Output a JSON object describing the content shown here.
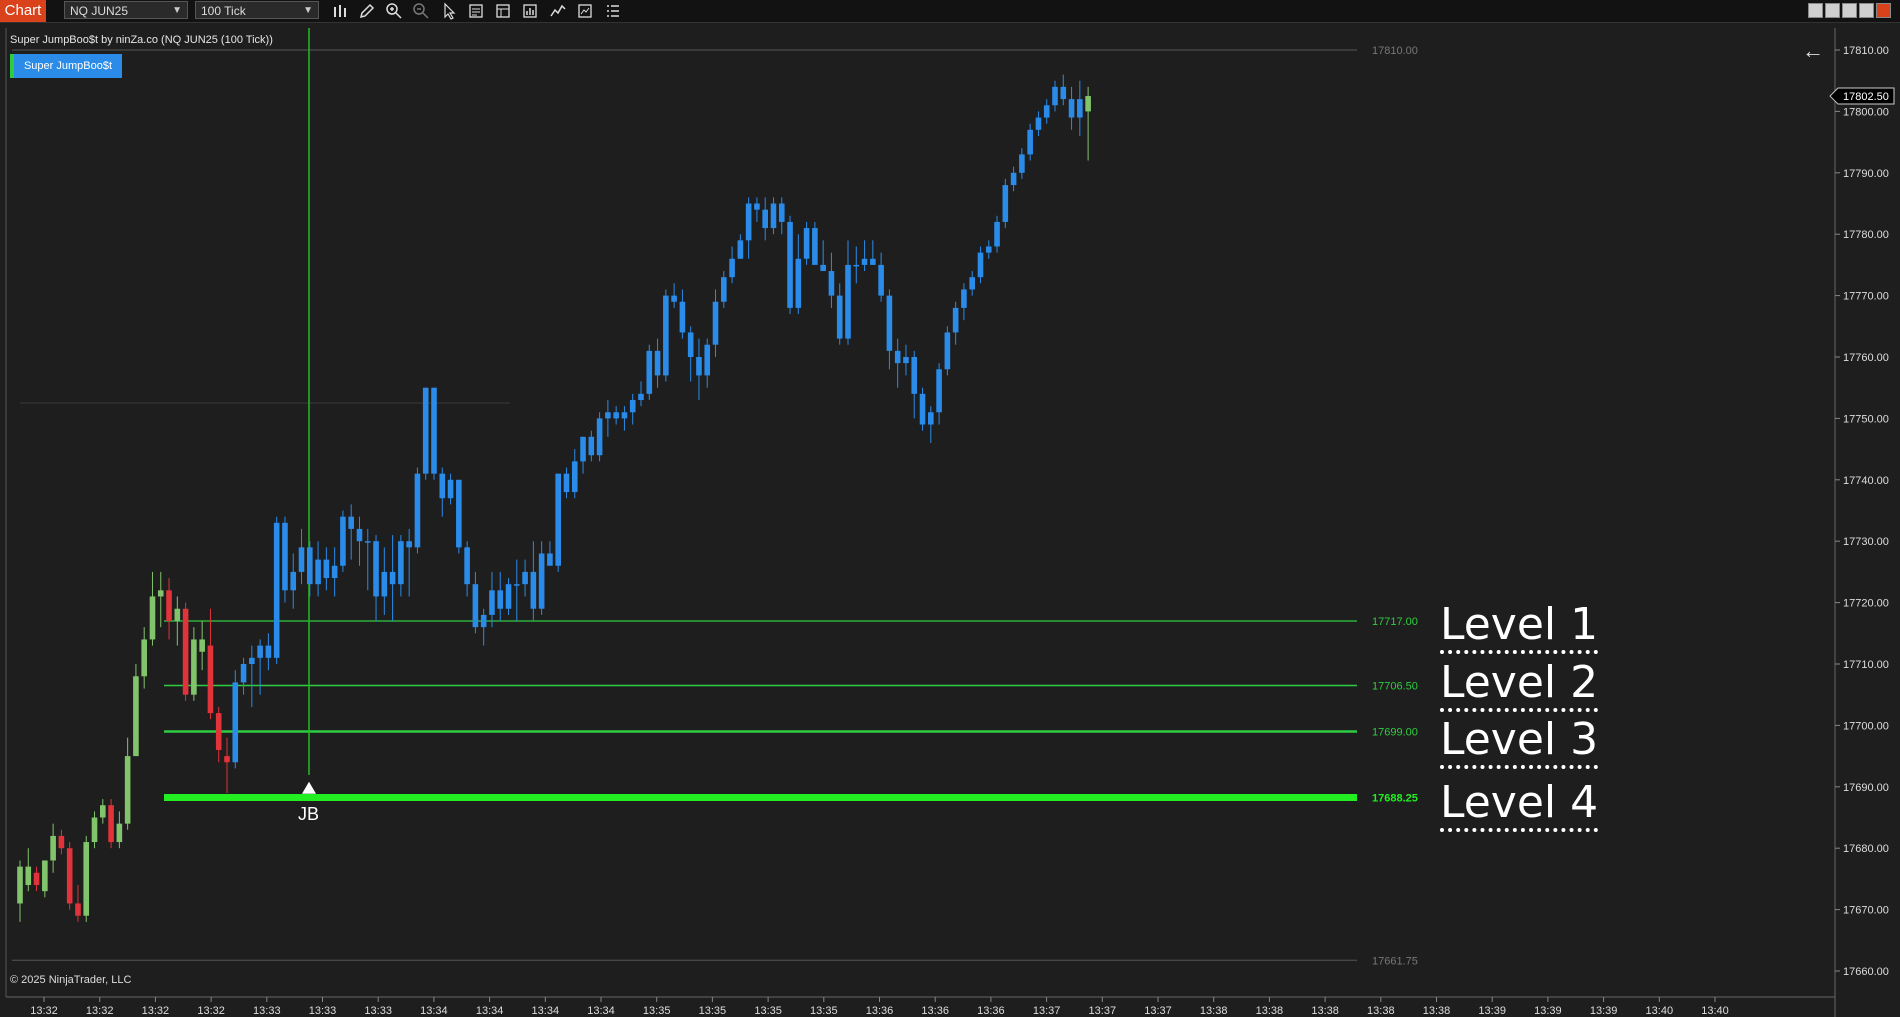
{
  "toolbar": {
    "chart_tab": "Chart",
    "instrument": "NQ JUN25",
    "interval": "100 Tick",
    "icons": [
      "bar-style-icon",
      "pencil-icon",
      "zoom-in-icon",
      "zoom-out-icon",
      "pointer-icon",
      "data-box-icon",
      "properties-icon",
      "chart-trader-icon",
      "indicators-icon",
      "strategies-icon",
      "list-icon"
    ]
  },
  "header": {
    "title": "Super JumpBoo$t by ninZa.co (NQ JUN25 (100 Tick))",
    "indicator_button": "Super JumpBoo$t"
  },
  "footer": {
    "copyright": "© 2025 NinjaTrader, LLC"
  },
  "colors": {
    "up": "#82c46c",
    "down": "#e0333a",
    "boost": "#2a8be8",
    "level": "#2ecc40",
    "level4": "#22ee22"
  },
  "chart_data": {
    "type": "candlestick",
    "ylim": [
      17658,
      17813
    ],
    "y_ticks": [
      "17810.00",
      "17800.00",
      "17790.00",
      "17780.00",
      "17770.00",
      "17760.00",
      "17750.00",
      "17740.00",
      "17730.00",
      "17720.00",
      "17710.00",
      "17700.00",
      "17690.00",
      "17680.00",
      "17670.00",
      "17660.00"
    ],
    "x_ticks": [
      "13:32",
      "13:32",
      "13:32",
      "13:32",
      "13:33",
      "13:33",
      "13:33",
      "13:34",
      "13:34",
      "13:34",
      "13:34",
      "13:35",
      "13:35",
      "13:35",
      "13:35",
      "13:36",
      "13:36",
      "13:36",
      "13:37",
      "13:37",
      "13:37",
      "13:38",
      "13:38",
      "13:38",
      "13:38",
      "13:38",
      "13:39",
      "13:39",
      "13:39",
      "13:40",
      "13:40"
    ],
    "last_price": "17802.50",
    "top_line": {
      "label": "17810.00",
      "value": 17810
    },
    "bottom_line": {
      "label": "17661.75",
      "value": 17661.75
    },
    "mid_line": {
      "value": 17752.5
    },
    "levels": [
      {
        "name": "Level 1",
        "label": "17717.00",
        "value": 17717
      },
      {
        "name": "Level 2",
        "label": "17706.50",
        "value": 17706.5
      },
      {
        "name": "Level 3",
        "label": "17699.00",
        "value": 17699
      },
      {
        "name": "Level 4",
        "label": "17688.25",
        "value": 17688.25
      }
    ],
    "signal": {
      "label": "JB",
      "value": 17690
    },
    "candles": [
      [
        17677,
        17671,
        17678,
        17668,
        "up"
      ],
      [
        17674,
        17677,
        17680,
        17673,
        "up"
      ],
      [
        17676,
        17674,
        17677,
        17673,
        "down"
      ],
      [
        17673,
        17678,
        17678,
        17672,
        "up"
      ],
      [
        17678,
        17682,
        17684,
        17676,
        "up"
      ],
      [
        17682,
        17680,
        17683,
        17679,
        "down"
      ],
      [
        17680,
        17671,
        17681,
        17670,
        "down"
      ],
      [
        17671,
        17669,
        17674,
        17668,
        "down"
      ],
      [
        17669,
        17681,
        17682,
        17668,
        "up"
      ],
      [
        17681,
        17685,
        17686,
        17680,
        "up"
      ],
      [
        17685,
        17687,
        17688,
        17684,
        "up"
      ],
      [
        17687,
        17681,
        17688,
        17680,
        "down"
      ],
      [
        17681,
        17684,
        17686,
        17680,
        "up"
      ],
      [
        17684,
        17695,
        17698,
        17683,
        "up"
      ],
      [
        17695,
        17708,
        17710,
        17695,
        "up"
      ],
      [
        17708,
        17714,
        17716,
        17706,
        "up"
      ],
      [
        17714,
        17721,
        17725,
        17713,
        "up"
      ],
      [
        17721,
        17722,
        17725,
        17716,
        "up"
      ],
      [
        17722,
        17717,
        17724,
        17714,
        "down"
      ],
      [
        17717,
        17719,
        17721,
        17713,
        "up"
      ],
      [
        17719,
        17705,
        17720,
        17704,
        "down"
      ],
      [
        17705,
        17714,
        17716,
        17704,
        "up"
      ],
      [
        17714,
        17712,
        17717,
        17709,
        "up"
      ],
      [
        17713,
        17702,
        17719,
        17701,
        "down"
      ],
      [
        17702,
        17696,
        17703,
        17694,
        "down"
      ],
      [
        17695,
        17694,
        17698,
        17689,
        "down"
      ],
      [
        17694,
        17707,
        17709,
        17693,
        "boost"
      ],
      [
        17707,
        17710,
        17711,
        17705,
        "boost"
      ],
      [
        17710,
        17711,
        17713,
        17703,
        "boost"
      ],
      [
        17711,
        17713,
        17714,
        17705,
        "boost"
      ],
      [
        17713,
        17711,
        17715,
        17709,
        "boost"
      ],
      [
        17711,
        17733,
        17734,
        17710,
        "boost"
      ],
      [
        17733,
        17722,
        17734,
        17720,
        "boost"
      ],
      [
        17722,
        17725,
        17728,
        17719,
        "boost"
      ],
      [
        17725,
        17729,
        17732,
        17723,
        "boost"
      ],
      [
        17729,
        17723,
        17730,
        17721,
        "boost"
      ],
      [
        17723,
        17727,
        17730,
        17721,
        "boost"
      ],
      [
        17727,
        17724,
        17729,
        17722,
        "boost"
      ],
      [
        17724,
        17726,
        17729,
        17721,
        "boost"
      ],
      [
        17726,
        17734,
        17735,
        17725,
        "boost"
      ],
      [
        17734,
        17732,
        17736,
        17727,
        "boost"
      ],
      [
        17732,
        17730,
        17734,
        17726,
        "boost"
      ],
      [
        17730,
        17730,
        17732,
        17722,
        "boost"
      ],
      [
        17730,
        17721,
        17731,
        17717,
        "boost"
      ],
      [
        17721,
        17725,
        17729,
        17718,
        "boost"
      ],
      [
        17725,
        17723,
        17731,
        17717,
        "boost"
      ],
      [
        17723,
        17730,
        17731,
        17721,
        "boost"
      ],
      [
        17730,
        17729,
        17732,
        17721,
        "boost"
      ],
      [
        17729,
        17741,
        17742,
        17728,
        "boost"
      ],
      [
        17741,
        17755,
        17755,
        17740,
        "boost"
      ],
      [
        17755,
        17741,
        17755,
        17740,
        "boost"
      ],
      [
        17741,
        17737,
        17742,
        17734,
        "boost"
      ],
      [
        17737,
        17740,
        17741,
        17736,
        "boost"
      ],
      [
        17740,
        17729,
        17740,
        17728,
        "boost"
      ],
      [
        17729,
        17723,
        17730,
        17721,
        "boost"
      ],
      [
        17723,
        17716,
        17725,
        17715,
        "boost"
      ],
      [
        17716,
        17718,
        17719,
        17713,
        "boost"
      ],
      [
        17718,
        17722,
        17725,
        17716,
        "boost"
      ],
      [
        17722,
        17719,
        17725,
        17717,
        "boost"
      ],
      [
        17719,
        17723,
        17724,
        17718,
        "boost"
      ],
      [
        17723,
        17723,
        17727,
        17717,
        "boost"
      ],
      [
        17723,
        17725,
        17727,
        17721,
        "boost"
      ],
      [
        17725,
        17719,
        17730,
        17717,
        "boost"
      ],
      [
        17719,
        17728,
        17730,
        17718,
        "boost"
      ],
      [
        17728,
        17726,
        17730,
        17726,
        "boost"
      ],
      [
        17726,
        17741,
        17741,
        17725,
        "boost"
      ],
      [
        17741,
        17738,
        17742,
        17737,
        "boost"
      ],
      [
        17738,
        17743,
        17745,
        17737,
        "boost"
      ],
      [
        17743,
        17747,
        17747,
        17741,
        "boost"
      ],
      [
        17747,
        17744,
        17748,
        17743,
        "boost"
      ],
      [
        17744,
        17750,
        17751,
        17743,
        "boost"
      ],
      [
        17750,
        17751,
        17753,
        17747,
        "boost"
      ],
      [
        17751,
        17750,
        17752,
        17749,
        "boost"
      ],
      [
        17750,
        17751,
        17752,
        17748,
        "boost"
      ],
      [
        17751,
        17753,
        17754,
        17749,
        "boost"
      ],
      [
        17753,
        17754,
        17756,
        17752,
        "boost"
      ],
      [
        17754,
        17761,
        17762,
        17753,
        "boost"
      ],
      [
        17761,
        17757,
        17763,
        17755,
        "boost"
      ],
      [
        17757,
        17770,
        17771,
        17756,
        "boost"
      ],
      [
        17770,
        17769,
        17772,
        17768,
        "boost"
      ],
      [
        17769,
        17764,
        17771,
        17763,
        "boost"
      ],
      [
        17764,
        17760,
        17765,
        17756,
        "boost"
      ],
      [
        17760,
        17757,
        17763,
        17753,
        "boost"
      ],
      [
        17757,
        17762,
        17763,
        17755,
        "boost"
      ],
      [
        17762,
        17769,
        17771,
        17760,
        "boost"
      ],
      [
        17769,
        17773,
        17774,
        17768,
        "boost"
      ],
      [
        17773,
        17776,
        17778,
        17772,
        "boost"
      ],
      [
        17776,
        17779,
        17780,
        17776,
        "boost"
      ],
      [
        17779,
        17785,
        17786,
        17776,
        "boost"
      ],
      [
        17785,
        17784,
        17786,
        17782,
        "boost"
      ],
      [
        17784,
        17781,
        17786,
        17779,
        "boost"
      ],
      [
        17781,
        17785,
        17786,
        17780,
        "boost"
      ],
      [
        17785,
        17782,
        17786,
        17780,
        "boost"
      ],
      [
        17782,
        17768,
        17783,
        17767,
        "boost"
      ],
      [
        17768,
        17776,
        17780,
        17767,
        "boost"
      ],
      [
        17776,
        17781,
        17782,
        17775,
        "boost"
      ],
      [
        17781,
        17775,
        17782,
        17775,
        "boost"
      ],
      [
        17775,
        17774,
        17779,
        17774,
        "boost"
      ],
      [
        17774,
        17770,
        17777,
        17768,
        "boost"
      ],
      [
        17770,
        17763,
        17772,
        17762,
        "boost"
      ],
      [
        17763,
        17775,
        17779,
        17762,
        "boost"
      ],
      [
        17775,
        17775,
        17778,
        17772,
        "boost"
      ],
      [
        17775,
        17776,
        17779,
        17774,
        "boost"
      ],
      [
        17776,
        17775,
        17779,
        17775,
        "boost"
      ],
      [
        17775,
        17770,
        17777,
        17769,
        "boost"
      ],
      [
        17770,
        17761,
        17771,
        17758,
        "boost"
      ],
      [
        17761,
        17759,
        17763,
        17755,
        "boost"
      ],
      [
        17759,
        17760,
        17762,
        17757,
        "boost"
      ],
      [
        17760,
        17754,
        17761,
        17750,
        "boost"
      ],
      [
        17754,
        17749,
        17755,
        17748,
        "boost"
      ],
      [
        17749,
        17751,
        17752,
        17746,
        "boost"
      ],
      [
        17751,
        17758,
        17759,
        17749,
        "boost"
      ],
      [
        17758,
        17764,
        17765,
        17757,
        "boost"
      ],
      [
        17764,
        17768,
        17769,
        17762,
        "boost"
      ],
      [
        17768,
        17771,
        17772,
        17766,
        "boost"
      ],
      [
        17771,
        17773,
        17774,
        17770,
        "boost"
      ],
      [
        17773,
        17777,
        17778,
        17772,
        "boost"
      ],
      [
        17777,
        17778,
        17779,
        17776,
        "boost"
      ],
      [
        17778,
        17782,
        17783,
        17777,
        "boost"
      ],
      [
        17782,
        17788,
        17789,
        17781,
        "boost"
      ],
      [
        17788,
        17790,
        17791,
        17787,
        "boost"
      ],
      [
        17790,
        17793,
        17794,
        17789,
        "boost"
      ],
      [
        17793,
        17797,
        17798,
        17792,
        "boost"
      ],
      [
        17797,
        17799,
        17800,
        17796,
        "boost"
      ],
      [
        17799,
        17801,
        17802,
        17798,
        "boost"
      ],
      [
        17801,
        17804,
        17805,
        17800,
        "boost"
      ],
      [
        17804,
        17802,
        17806,
        17801,
        "boost"
      ],
      [
        17802,
        17799,
        17804,
        17797,
        "boost"
      ],
      [
        17799,
        17802,
        17805,
        17796,
        "boost"
      ],
      [
        17800,
        17802.5,
        17804,
        17792,
        "up"
      ]
    ]
  }
}
